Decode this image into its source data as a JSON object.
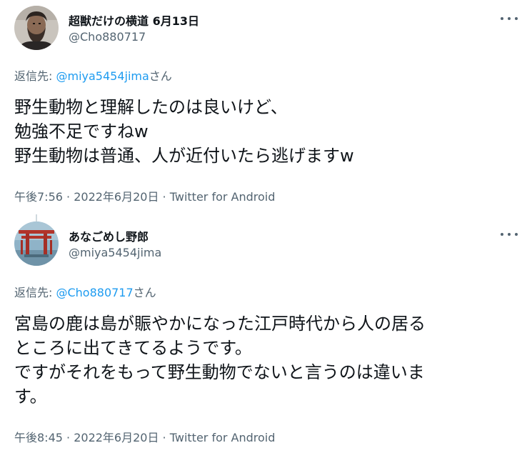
{
  "tweets": [
    {
      "name": "超獣だけの横道 6月13日",
      "handle": "@Cho880717",
      "reply_prefix": "返信先: ",
      "reply_to": "@miya5454jima",
      "reply_suffix": "さん",
      "text": "野生動物と理解したのは良いけど、\n勉強不足ですねw\n野生動物は普通、人が近付いたら逃げますw",
      "time": "午後7:56",
      "date": "2022年6月20日",
      "separator": " · ",
      "source": "Twitter for Android",
      "avatar_icon": "bearded-man-avatar"
    },
    {
      "name": "あなごめし野郎",
      "handle": "@miya5454jima",
      "reply_prefix": "返信先: ",
      "reply_to": "@Cho880717",
      "reply_suffix": "さん",
      "text": "宮島の鹿は島が賑やかになった江戸時代から人の居る\nところに出てきてるようです。\nですがそれをもって野生動物でないと言うのは違いま\nす。",
      "time": "午後8:45",
      "date": "2022年6月20日",
      "separator": " · ",
      "source": "Twitter for Android",
      "avatar_icon": "torii-gate-avatar"
    }
  ],
  "colors": {
    "text": "#0f1419",
    "secondary": "#536471",
    "link": "#1d9bf0",
    "line": "#cfd9de"
  }
}
